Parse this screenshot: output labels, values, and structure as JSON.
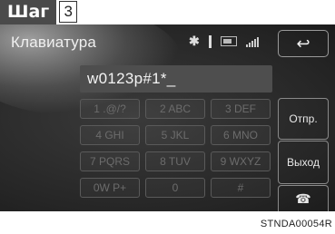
{
  "step": {
    "label": "Шаг",
    "number": "3"
  },
  "header": {
    "title": "Клавиатура",
    "bluetooth": "✱",
    "back_icon": "↩"
  },
  "input": {
    "value": "w0123p#1*_"
  },
  "keypad": [
    [
      "1 .@/?",
      "2 ABC",
      "3 DEF"
    ],
    [
      "4 GHI",
      "5 JKL",
      "6 MNO"
    ],
    [
      "7 PQRS",
      "8 TUV",
      "9 WXYZ"
    ],
    [
      "0W P+",
      "0",
      "#"
    ]
  ],
  "side_buttons": {
    "send": "Отпр.",
    "exit": "Выход",
    "call_icon": "☎"
  },
  "footer_code": "STNDA00054R",
  "colors": {
    "screen_bg": "#2b2b2b",
    "step_bg": "#4a4a4a",
    "key_text_disabled": "#6c6c6c"
  }
}
